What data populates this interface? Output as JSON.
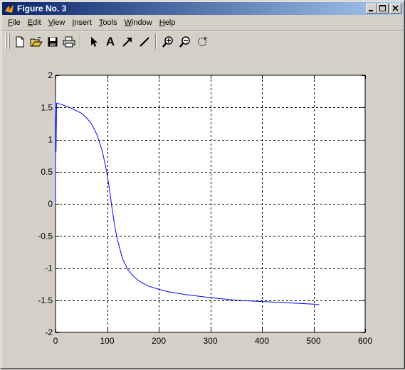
{
  "window": {
    "title": "Figure No. 3",
    "buttons": [
      "minimize",
      "maximize",
      "close"
    ]
  },
  "menubar": {
    "items": [
      {
        "label": "File",
        "accel": "F",
        "rest": "ile"
      },
      {
        "label": "Edit",
        "accel": "E",
        "rest": "dit"
      },
      {
        "label": "View",
        "accel": "V",
        "rest": "iew"
      },
      {
        "label": "Insert",
        "accel": "I",
        "rest": "nsert"
      },
      {
        "label": "Tools",
        "accel": "T",
        "rest": "ools"
      },
      {
        "label": "Window",
        "accel": "W",
        "rest": "indow"
      },
      {
        "label": "Help",
        "accel": "H",
        "rest": "elp"
      }
    ]
  },
  "toolbar": {
    "tools": [
      "new-file-icon",
      "open-folder-icon",
      "save-icon",
      "print-icon",
      "select-arrow-icon",
      "insert-text-icon",
      "insert-arrow-icon",
      "insert-line-icon",
      "zoom-in-icon",
      "zoom-out-icon",
      "rotate-3d-icon"
    ],
    "text_tool_label": "A"
  },
  "chart_data": {
    "type": "line",
    "title": "",
    "xlabel": "",
    "ylabel": "",
    "xlim": [
      0,
      600
    ],
    "ylim": [
      -2,
      2
    ],
    "xticks": [
      0,
      100,
      200,
      300,
      400,
      500,
      600
    ],
    "xtick_labels": [
      "0",
      "100",
      "200",
      "300",
      "400",
      "500",
      "600"
    ],
    "yticks": [
      -2,
      -1.5,
      -1,
      -0.5,
      0,
      0.5,
      1,
      1.5,
      2
    ],
    "ytick_labels": [
      "-2",
      "-1.5",
      "-1",
      "-0.5",
      "0",
      "0.5",
      "1",
      "1.5",
      "2"
    ],
    "grid": true,
    "grid_style": "dashed",
    "line_color": "#0000ff",
    "series": [
      {
        "x": [
          0,
          0,
          1,
          2,
          3,
          5,
          10,
          20,
          30,
          40,
          50,
          60,
          70,
          80,
          90,
          95,
          100,
          105,
          110,
          115,
          120,
          130,
          140,
          150,
          160,
          170,
          180,
          200,
          220,
          250,
          300,
          350,
          400,
          450,
          500,
          511
        ],
        "y": [
          0.0,
          1.58,
          0.8,
          1.56,
          1.57,
          1.56,
          1.55,
          1.52,
          1.49,
          1.45,
          1.41,
          1.34,
          1.24,
          1.08,
          0.84,
          0.66,
          0.46,
          0.2,
          -0.1,
          -0.36,
          -0.56,
          -0.86,
          -1.02,
          -1.12,
          -1.19,
          -1.24,
          -1.28,
          -1.33,
          -1.37,
          -1.41,
          -1.46,
          -1.5,
          -1.52,
          -1.54,
          -1.56,
          -1.57
        ]
      }
    ]
  }
}
